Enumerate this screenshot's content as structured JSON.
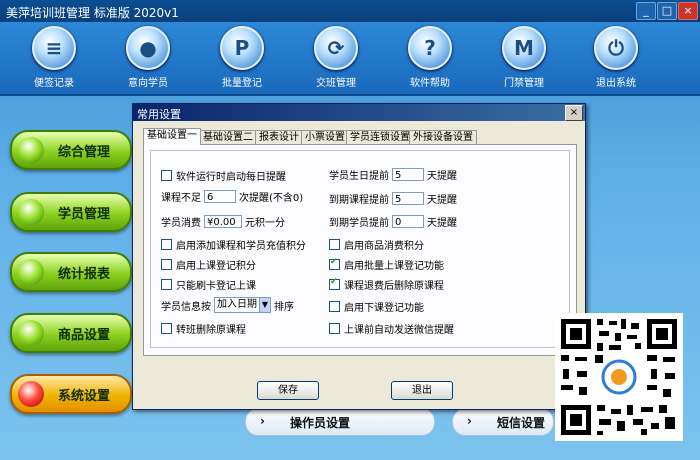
{
  "window": {
    "title": "美萍培训班管理 标准版  2020v1"
  },
  "toolbar": {
    "items": [
      {
        "label": "便签记录",
        "icon": "note-icon",
        "glyph": "≡"
      },
      {
        "label": "意向学员",
        "icon": "person-icon",
        "glyph": "●"
      },
      {
        "label": "批量登记",
        "icon": "p-icon",
        "glyph": "P"
      },
      {
        "label": "交班管理",
        "icon": "refresh-icon",
        "glyph": "⟳"
      },
      {
        "label": "软件帮助",
        "icon": "question-icon",
        "glyph": "?"
      },
      {
        "label": "门禁管理",
        "icon": "m-icon",
        "glyph": "M"
      },
      {
        "label": "退出系统",
        "icon": "power-icon",
        "glyph": "⏻"
      }
    ]
  },
  "sidebar": {
    "items": [
      {
        "label": "综合管理"
      },
      {
        "label": "学员管理"
      },
      {
        "label": "统计报表"
      },
      {
        "label": "商品设置"
      },
      {
        "label": "系统设置"
      }
    ]
  },
  "background_cards": {
    "operator": "操作员设置",
    "sms": "短信设置",
    "arrow": "›"
  },
  "dialog": {
    "title": "常用设置",
    "tabs": [
      "基础设置一",
      "基础设置二",
      "报表设计",
      "小票设置",
      "学员连锁设置",
      "外接设备设置"
    ],
    "left": {
      "startup_remind": {
        "label": "软件运行时启动每日提醒",
        "checked": false
      },
      "course_low": {
        "prefix": "课程不足",
        "value": "6",
        "suffix": "次提醒(不含0)"
      },
      "consume": {
        "prefix": "学员消费",
        "value": "¥0.00",
        "suffix": "元积一分"
      },
      "enable_points": {
        "label": "启用添加课程和学员充值积分",
        "checked": false
      },
      "enable_class_points": {
        "label": "启用上课登记积分",
        "checked": false
      },
      "card_only": {
        "label": "只能刷卡登记上课",
        "checked": false
      },
      "sort": {
        "prefix": "学员信息按",
        "value": "加入日期",
        "suffix": "排序"
      },
      "transfer_delete": {
        "label": "转班删除原课程",
        "checked": false
      }
    },
    "right": {
      "birthday": {
        "prefix": "学员生日提前",
        "value": "5",
        "suffix": "天提醒"
      },
      "course_expire": {
        "prefix": "到期课程提前",
        "value": "5",
        "suffix": "天提醒"
      },
      "student_expire": {
        "prefix": "到期学员提前",
        "value": "0",
        "suffix": "天提醒"
      },
      "goods_points": {
        "label": "启用商品消费积分",
        "checked": false
      },
      "batch_register": {
        "label": "启用批量上课登记功能",
        "checked": true
      },
      "refund_delete": {
        "label": "课程退费后删除原课程",
        "checked": true
      },
      "end_class": {
        "label": "启用下课登记功能",
        "checked": false
      },
      "wechat": {
        "label": "上课前自动发送微信提醒",
        "checked": false
      }
    },
    "buttons": {
      "save": "保存",
      "exit": "退出"
    }
  },
  "window_buttons": {
    "minimize": "_",
    "restore": "□",
    "close": "×"
  }
}
